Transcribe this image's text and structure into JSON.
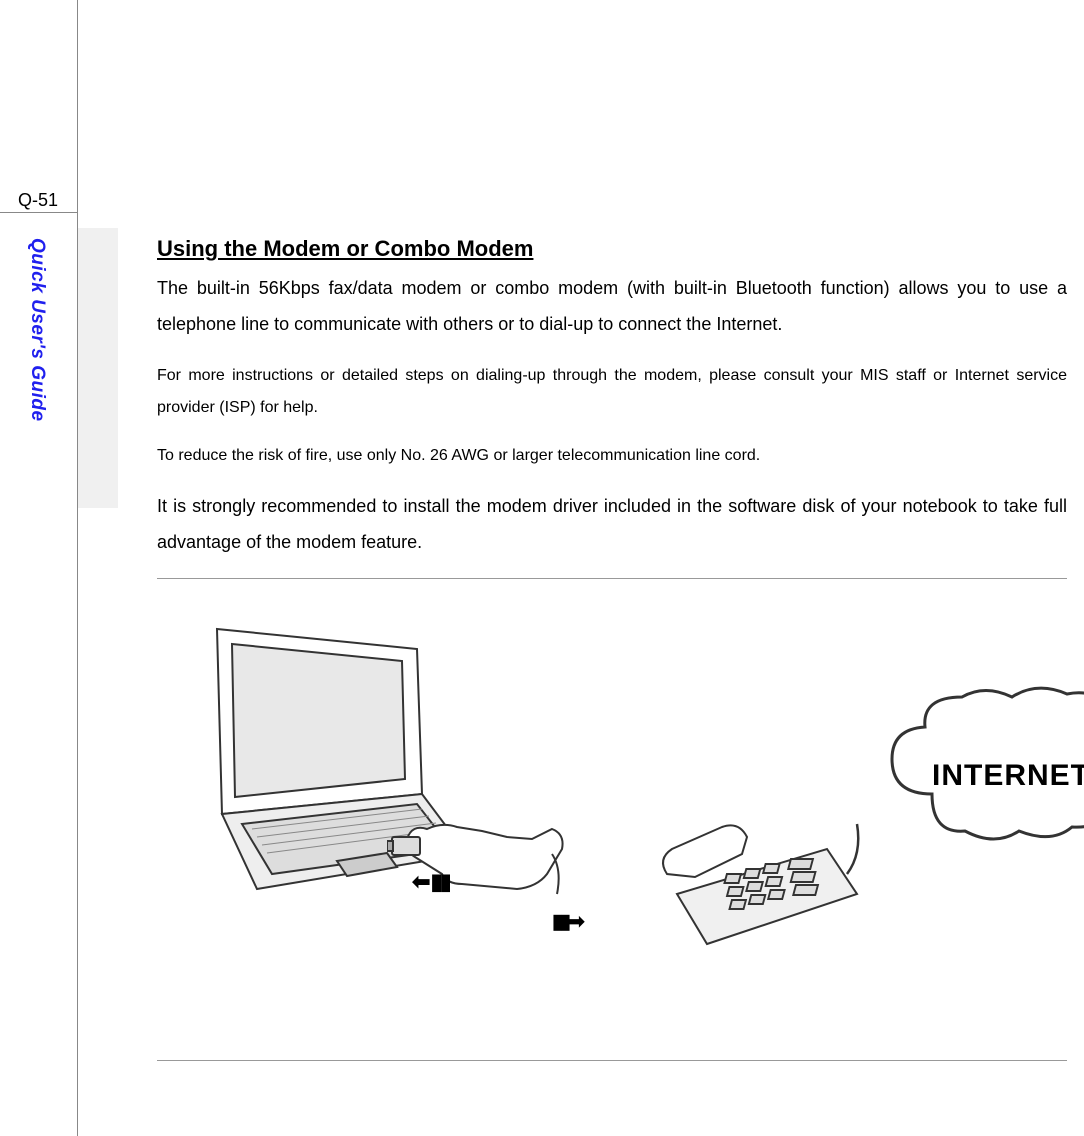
{
  "page_number": "Q-51",
  "sidebar_label": "Quick User's Guide",
  "heading": "Using the Modem or Combo Modem",
  "paragraphs": {
    "p1": "The built-in 56Kbps fax/data modem or combo modem (with built-in Bluetooth function) allows you to use a telephone line to communicate with others or to dial-up to connect the Internet.",
    "p2": "For more instructions or detailed steps on dialing-up through the modem, please consult your MIS staff or Internet service provider (ISP) for help.",
    "p3": "To reduce the risk of fire, use only No. 26 AWG or larger telecommunication line cord.",
    "p4": "It is strongly recommended to install the modem driver included in the software disk of your notebook to take full advantage of the modem feature."
  },
  "diagram": {
    "cloud_label": "INTERNET",
    "icons": {
      "laptop": "laptop-icon",
      "hand": "hand-connector-icon",
      "arrow_left": "arrow-left-icon",
      "arrow_right": "arrow-right-icon",
      "phone": "telephone-icon",
      "cloud": "cloud-icon"
    }
  }
}
